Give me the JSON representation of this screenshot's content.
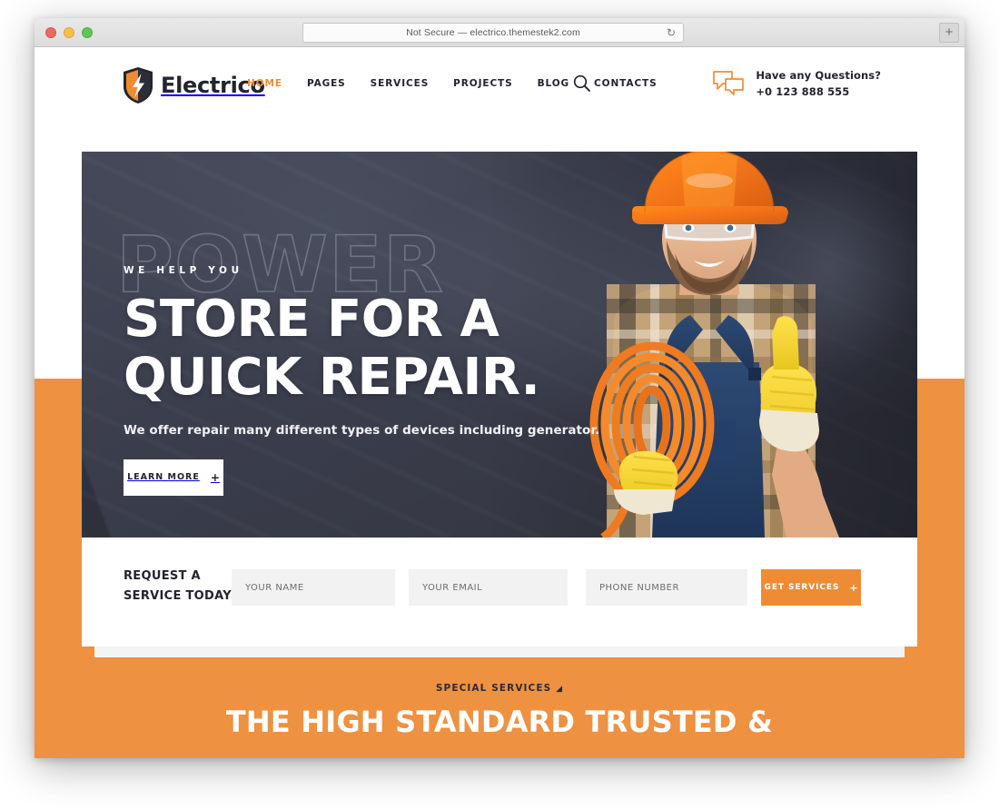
{
  "browser": {
    "url_text": "Not Secure — electrico.themestek2.com",
    "reload_icon": "↻",
    "new_tab_label": "+",
    "traffic_lights": [
      "close-red",
      "minimize-yellow",
      "zoom-green"
    ]
  },
  "header": {
    "logo_text": "Electrico",
    "logo_icon": "shield-bolt-icon",
    "nav": [
      {
        "label": "HOME",
        "active": true
      },
      {
        "label": "PAGES",
        "active": false
      },
      {
        "label": "SERVICES",
        "active": false
      },
      {
        "label": "PROJECTS",
        "active": false
      },
      {
        "label": "BLOG",
        "active": false
      },
      {
        "label": "CONTACTS",
        "active": false
      }
    ],
    "search_icon": "search-icon",
    "contact": {
      "icon": "chat-bubbles-icon",
      "question": "Have any Questions?",
      "phone": "+0 123 888 555"
    }
  },
  "hero": {
    "watermark": "POWER",
    "eyebrow": "WE HELP YOU",
    "title_line1": "STORE FOR A",
    "title_line2": "QUICK REPAIR.",
    "subtitle": "We offer repair many different types of devices including generator.",
    "cta_label": "LEARN MORE",
    "cta_plus": "+",
    "photo_alt": "electrician-with-hardhat-and-cable"
  },
  "form": {
    "title_line1": "REQUEST A",
    "title_line2": "SERVICE TODAY",
    "fields": [
      {
        "name": "your-name",
        "placeholder": "YOUR NAME",
        "value": ""
      },
      {
        "name": "your-email",
        "placeholder": "YOUR EMAIL",
        "value": ""
      },
      {
        "name": "phone-number",
        "placeholder": "PHONE NUMBER",
        "value": ""
      }
    ],
    "submit_label": "GET SERVICES",
    "submit_plus": "+"
  },
  "special": {
    "eyebrow": "SPECIAL SERVICES",
    "eyebrow_mark": "◢",
    "heading": "THE HIGH STANDARD TRUSTED &"
  },
  "colors": {
    "accent_orange": "#ee9141",
    "nav_active_orange": "#ef8c33",
    "dark_navy": "#3a3d4c",
    "text_dark": "#22242e",
    "field_gray": "#f2f2f2"
  }
}
